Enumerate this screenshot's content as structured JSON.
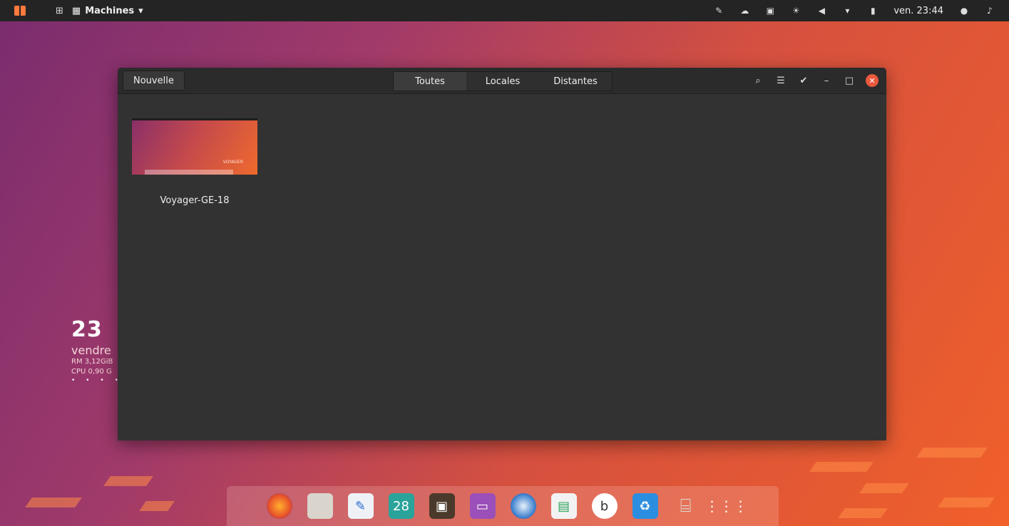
{
  "topbar": {
    "app_name": "Machines",
    "clock": "ven. 23:44",
    "left_icons": [
      "ubuntu-logo-icon",
      "activities-grid-icon",
      "machines-app-icon"
    ],
    "right_icons": [
      "pen-icon",
      "cloud-icon",
      "terminal-icon",
      "brightness-icon",
      "volume-icon",
      "wifi-icon",
      "battery-icon",
      "user-icon",
      "bell-icon"
    ]
  },
  "desktop_widget": {
    "time": "23",
    "day": "vendre",
    "ram": "RM 3,12GiB",
    "cpu": "CPU 0,90 G",
    "dots": "• • • •"
  },
  "window": {
    "new_button": "Nouvelle",
    "tabs": [
      {
        "label": "Toutes",
        "active": true
      },
      {
        "label": "Locales",
        "active": false
      },
      {
        "label": "Distantes",
        "active": false
      }
    ],
    "header_icons": [
      "search-icon",
      "list-view-icon",
      "select-check-icon",
      "minimize-icon",
      "maximize-icon",
      "close-icon"
    ],
    "machines": [
      {
        "name": "Voyager-GE-18",
        "thumb_label": "VOYAGER"
      }
    ]
  },
  "dock": {
    "apps": [
      {
        "icon": "firefox-icon",
        "label": ""
      },
      {
        "icon": "files-icon",
        "label": ""
      },
      {
        "icon": "text-editor-icon",
        "label": ""
      },
      {
        "icon": "calendar-icon",
        "label": "28"
      },
      {
        "icon": "tv-icon",
        "label": ""
      },
      {
        "icon": "window-app-icon",
        "label": ""
      },
      {
        "icon": "thunderbird-icon",
        "label": ""
      },
      {
        "icon": "settings-toggle-icon",
        "label": ""
      },
      {
        "icon": "b-app-icon",
        "label": "b"
      },
      {
        "icon": "recycle-icon",
        "label": "♻"
      },
      {
        "icon": "cube-app-icon",
        "label": ""
      },
      {
        "icon": "app-grid-icon",
        "label": ""
      }
    ]
  },
  "colors": {
    "accent": "#e9593e",
    "topbar": "#242424",
    "window_bg": "#323232"
  }
}
